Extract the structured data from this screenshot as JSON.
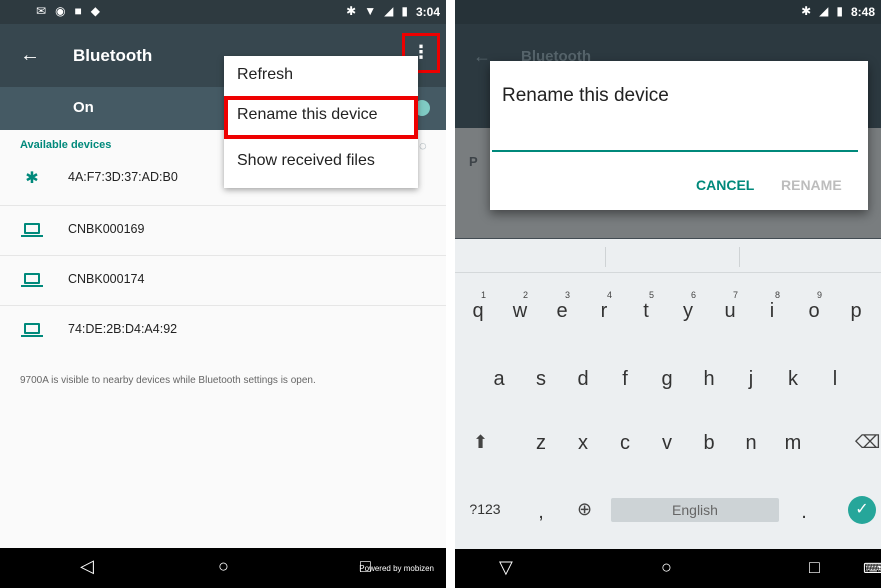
{
  "left": {
    "status": {
      "time": "3:04"
    },
    "appbar": {
      "title": "Bluetooth",
      "back_icon": "←",
      "overflow_icon": "⋮"
    },
    "toggle": {
      "label": "On"
    },
    "menu": {
      "items": [
        "Refresh",
        "Rename this device",
        "Show received files"
      ]
    },
    "section_header": "Available devices",
    "devices": [
      {
        "name": "4A:F7:3D:37:AD:B0",
        "icon": "bluetooth-icon"
      },
      {
        "name": "CNBK000169",
        "icon": "laptop-icon"
      },
      {
        "name": "CNBK000174",
        "icon": "laptop-icon"
      },
      {
        "name": "74:DE:2B:D4:A4:92",
        "icon": "laptop-icon"
      }
    ],
    "visibility_note": "9700A is visible to nearby devices while Bluetooth settings is open.",
    "powered_by": "Powered by mobizen"
  },
  "right": {
    "status": {
      "time": "8:48"
    },
    "appbar": {
      "title": "Bluetooth"
    },
    "dimmed_letter": "P",
    "dialog": {
      "title": "Rename this device",
      "cancel": "CANCEL",
      "rename": "RENAME"
    },
    "keyboard": {
      "row1": [
        "q",
        "w",
        "e",
        "r",
        "t",
        "y",
        "u",
        "i",
        "o",
        "p"
      ],
      "row1_numbers": [
        "1",
        "2",
        "3",
        "4",
        "5",
        "6",
        "7",
        "8",
        "9"
      ],
      "row2": [
        "a",
        "s",
        "d",
        "f",
        "g",
        "h",
        "j",
        "k",
        "l"
      ],
      "row3": [
        "z",
        "x",
        "c",
        "v",
        "b",
        "n",
        "m"
      ],
      "symbols_key": "?123",
      "comma_key": ",",
      "period_key": ".",
      "space_label": "English"
    }
  },
  "colors": {
    "accent": "#00897b",
    "highlight": "#e00000",
    "appbar": "#37474f"
  }
}
